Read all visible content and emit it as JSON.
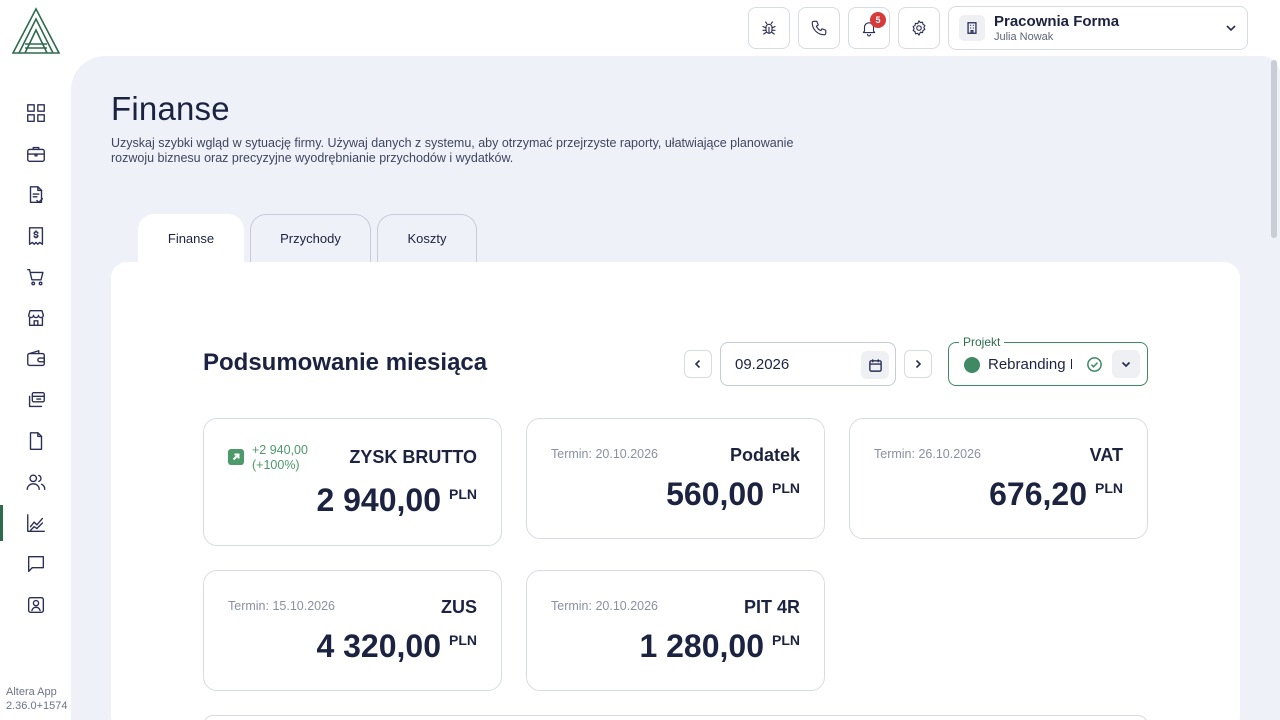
{
  "app": {
    "version_line1": "Altera App",
    "version_line2": "2.36.0+1574"
  },
  "sidebar": {
    "items": [
      {
        "icon": "dashboard-icon"
      },
      {
        "icon": "briefcase-icon"
      },
      {
        "icon": "invoice-check-icon"
      },
      {
        "icon": "dollar-document-icon"
      },
      {
        "icon": "cart-icon"
      },
      {
        "icon": "store-icon"
      },
      {
        "icon": "wallet-icon"
      },
      {
        "icon": "transfer-cards-icon"
      },
      {
        "icon": "file-icon"
      },
      {
        "icon": "users-icon"
      },
      {
        "icon": "chart-line-icon",
        "active": true
      },
      {
        "icon": "chat-icon"
      },
      {
        "icon": "contact-card-icon"
      }
    ]
  },
  "topbar": {
    "notifications_count": "5",
    "company_name": "Pracownia Forma",
    "user_name": "Julia Nowak"
  },
  "page": {
    "title": "Finanse",
    "description": "Uzyskaj szybki wgląd w sytuację firmy. Używaj danych z systemu, aby otrzymać przejrzyste raporty, ułatwiające planowanie rozwoju biznesu oraz precyzyjne wyodrębnianie przychodów i wydatków."
  },
  "tabs": [
    {
      "label": "Finanse",
      "active": true
    },
    {
      "label": "Przychody",
      "active": false
    },
    {
      "label": "Koszty",
      "active": false
    }
  ],
  "summary": {
    "title": "Podsumowanie miesiąca",
    "month": "09.2026",
    "project_label": "Projekt",
    "project_value": "Rebranding F",
    "project_color": "#3f8a65",
    "cards": {
      "gross": {
        "label": "ZYSK BRUTTO",
        "amount": "2 940,00",
        "currency": "PLN",
        "trend_value": "+2 940,00",
        "trend_percent": "(+100%)"
      },
      "tax": {
        "label": "Podatek",
        "deadline": "Termin: 20.10.2026",
        "amount": "560,00",
        "currency": "PLN"
      },
      "vat": {
        "label": "VAT",
        "deadline": "Termin: 26.10.2026",
        "amount": "676,20",
        "currency": "PLN"
      },
      "zus": {
        "label": "ZUS",
        "deadline": "Termin: 15.10.2026",
        "amount": "4 320,00",
        "currency": "PLN"
      },
      "pit": {
        "label": "PIT 4R",
        "deadline": "Termin: 20.10.2026",
        "amount": "1 280,00",
        "currency": "PLN"
      }
    }
  },
  "colors": {
    "accent": "#2e6b4e",
    "positive": "#4c9a6a",
    "badge": "#d63a3a",
    "text": "#1c2340"
  }
}
